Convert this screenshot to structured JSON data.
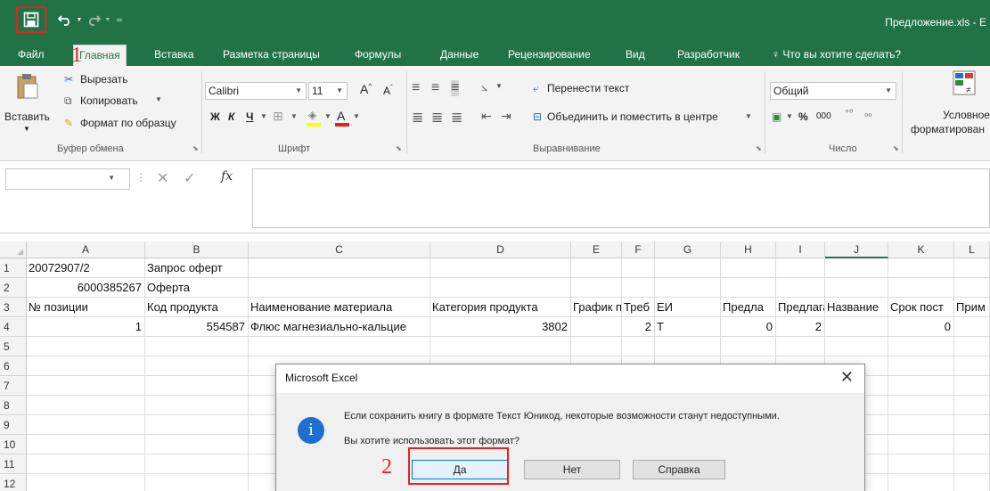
{
  "window": {
    "title": "Предложение.xls - E"
  },
  "quick_access": {
    "save_icon": "save-icon",
    "undo_icon": "undo-icon",
    "redo_icon": "redo-icon",
    "customize_icon": "customize-qat-icon"
  },
  "tabs": [
    {
      "label": "Файл"
    },
    {
      "label": "Главная"
    },
    {
      "label": "Вставка"
    },
    {
      "label": "Разметка страницы"
    },
    {
      "label": "Формулы"
    },
    {
      "label": "Данные"
    },
    {
      "label": "Рецензирование"
    },
    {
      "label": "Вид"
    },
    {
      "label": "Разработчик"
    },
    {
      "label": "Что вы хотите сделать?"
    }
  ],
  "ribbon": {
    "clipboard": {
      "paste": "Вставить",
      "cut": "Вырезать",
      "copy": "Копировать",
      "format_painter": "Формат по образцу",
      "group": "Буфер обмена"
    },
    "font": {
      "name": "Calibri",
      "size": "11",
      "bold": "Ж",
      "italic": "К",
      "underline": "Ч",
      "group": "Шрифт"
    },
    "alignment": {
      "wrap_text": "Перенести текст",
      "merge_center": "Объединить и поместить в центре",
      "group": "Выравнивание"
    },
    "number": {
      "format": "Общий",
      "percent": "%",
      "thousands": "000",
      "group": "Число"
    },
    "styles": {
      "conditional_line1": "Условное",
      "conditional_line2": "форматирован"
    }
  },
  "formula_bar": {
    "fx": "fx",
    "cancel": "✕",
    "enter": "✓"
  },
  "columns": [
    "A",
    "B",
    "C",
    "D",
    "E",
    "F",
    "G",
    "H",
    "I",
    "J",
    "K",
    "L"
  ],
  "rows": [
    "1",
    "2",
    "3",
    "4",
    "5",
    "6",
    "7",
    "8",
    "9",
    "10",
    "11",
    "12"
  ],
  "cells": {
    "A1": "20072907/2",
    "B1": "Запрос оферт",
    "A2": "6000385267",
    "B2": "Оферта",
    "A3": "№ позиции",
    "B3": "Код продукта",
    "C3": "Наименование материала",
    "D3": "Категория продукта",
    "E3": "График п",
    "F3": "Треб",
    "G3": "ЕИ",
    "H3": "Предла",
    "I3": "Предлага",
    "J3": "Название",
    "K3": "Срок пост",
    "L3": "Прим",
    "A4": "1",
    "B4": "554587",
    "C4": "Флюс магнезиально-кальцие",
    "D4": "3802",
    "F4": "2",
    "G4": "Т",
    "H4": "0",
    "I4": "2",
    "K4": "0"
  },
  "dialog": {
    "title": "Microsoft Excel",
    "message_line1": "Если сохранить книгу в формате Текст Юникод, некоторые возможности станут недоступными.",
    "message_line2": "Вы хотите использовать этот формат?",
    "yes": "Да",
    "no": "Нет",
    "help": "Справка"
  },
  "annotations": {
    "step1": "1",
    "step2": "2"
  },
  "colors": {
    "excel_green": "#217346",
    "highlight_red": "#e8211f",
    "info_blue": "#1e6fd0"
  }
}
